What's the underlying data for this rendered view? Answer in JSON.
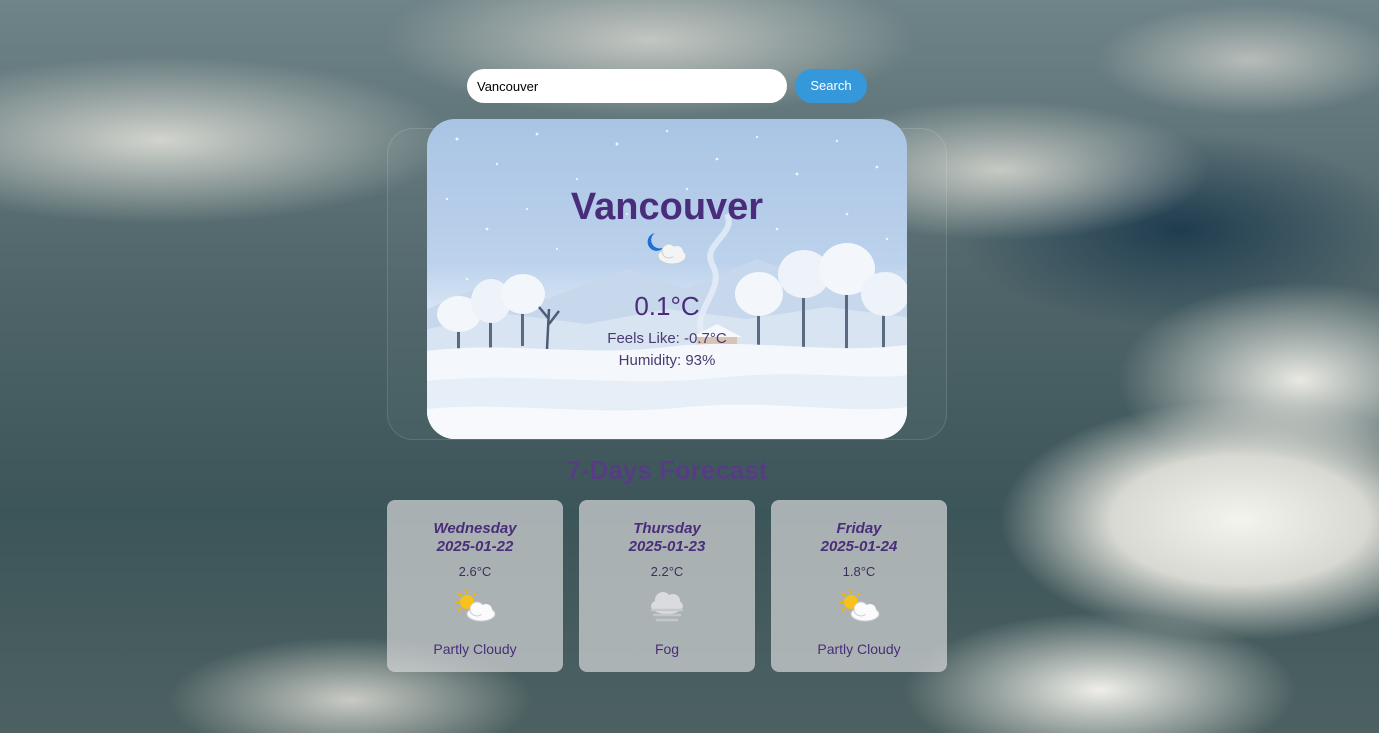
{
  "search": {
    "value": "Vancouver",
    "button_label": "Search"
  },
  "current": {
    "city": "Vancouver",
    "icon": "moon-cloud-icon",
    "temperature": "0.1°C",
    "feels_like": "Feels Like: -0.7°C",
    "humidity": "Humidity: 93%"
  },
  "forecast": {
    "title": "7-Days Forecast",
    "days": [
      {
        "day": "Wednesday",
        "date": "2025-01-22",
        "temp": "2.6°C",
        "icon": "partly-cloudy-icon",
        "condition": "Partly Cloudy"
      },
      {
        "day": "Thursday",
        "date": "2025-01-23",
        "temp": "2.2°C",
        "icon": "fog-icon",
        "condition": "Fog"
      },
      {
        "day": "Friday",
        "date": "2025-01-24",
        "temp": "1.8°C",
        "icon": "partly-cloudy-icon",
        "condition": "Partly Cloudy"
      }
    ]
  },
  "colors": {
    "accent": "#3498db",
    "text_purple": "#4a2d7a"
  }
}
